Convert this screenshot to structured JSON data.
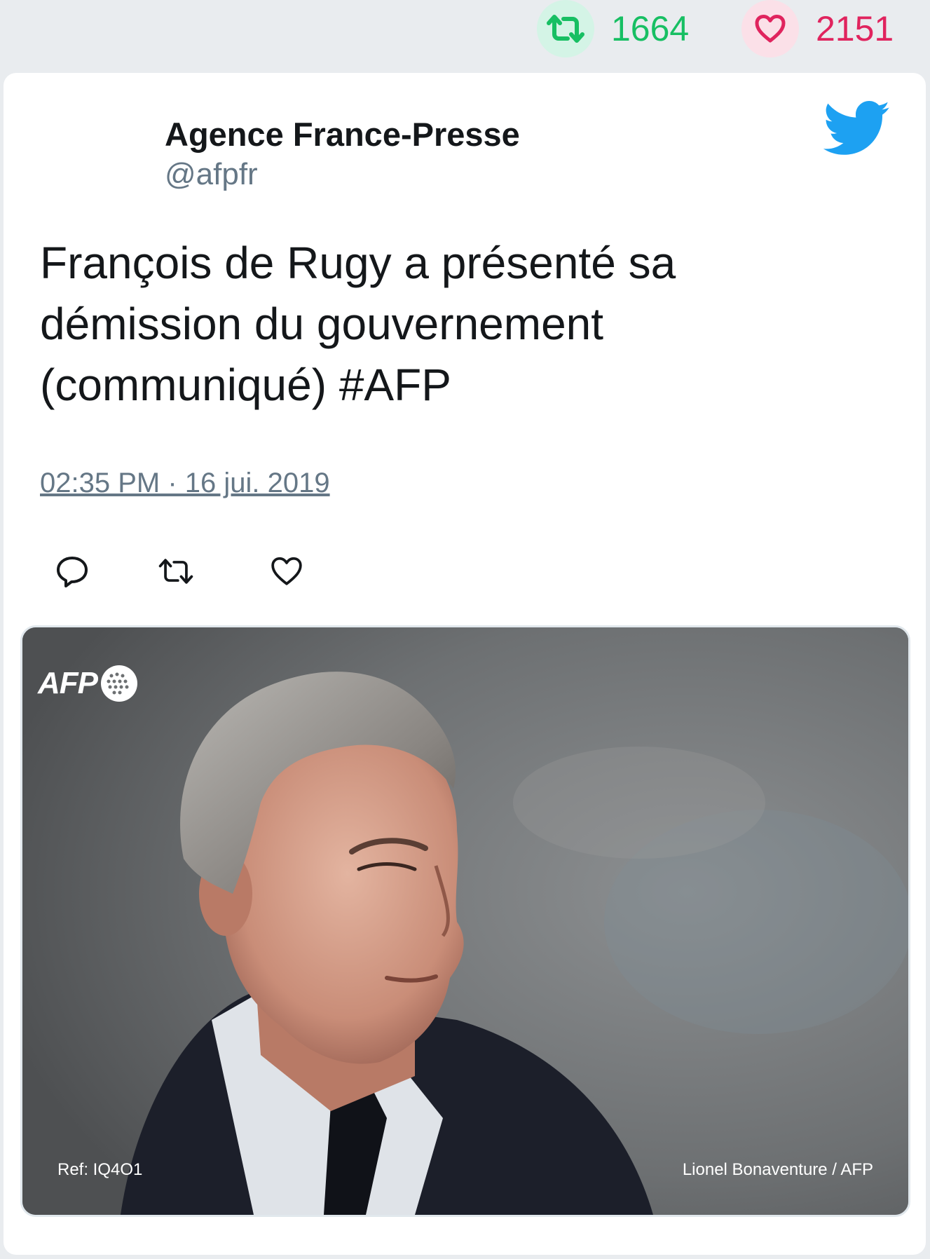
{
  "stats": {
    "retweet_count": "1664",
    "like_count": "2151",
    "retweet_icon": "retweet-icon",
    "like_icon": "heart-icon",
    "retweet_color": "#17bf63",
    "like_color": "#e0245e"
  },
  "tweet": {
    "author_name": "Agence France-Presse",
    "author_handle": "@afpfr",
    "brand_icon": "twitter-bird-icon",
    "brand_color": "#1da1f2",
    "text": "François de Rugy a présenté sa démission du gouvernement (communiqué) #AFP",
    "timestamp": "02:35 PM · 16 jui. 2019",
    "actions": [
      "reply-icon",
      "retweet-icon",
      "like-icon"
    ]
  },
  "photo": {
    "logo_text": "AFP",
    "ref": "Ref: IQ4O1",
    "credit": "Lionel Bonaventure / AFP"
  }
}
